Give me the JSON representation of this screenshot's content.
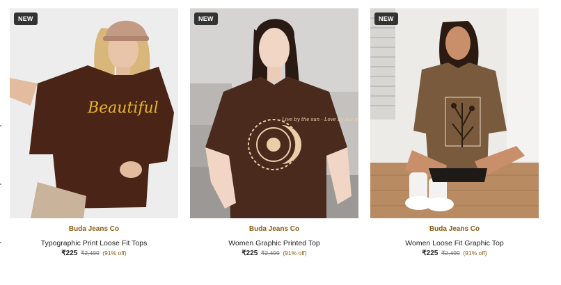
{
  "products": [
    {
      "badge": "NEW",
      "brand": "Buda Jeans Co",
      "name": "Typographic Print Loose Fit Tops",
      "price": "₹225",
      "mrp": "₹2,499",
      "discount": "(91% off)",
      "print_text": "Beautiful"
    },
    {
      "badge": "NEW",
      "brand": "Buda Jeans Co",
      "name": "Women Graphic Printed Top",
      "price": "₹225",
      "mrp": "₹2,499",
      "discount": "(91% off)",
      "print_text": "Live by the sun · Love by the moon"
    },
    {
      "badge": "NEW",
      "brand": "Buda Jeans Co",
      "name": "Women Loose Fit Graphic Top",
      "price": "₹225",
      "mrp": "₹2,499",
      "discount": "(91% off)",
      "print_text": ""
    }
  ],
  "colors": {
    "brand": "#8a5a12",
    "badge_bg": "#333333",
    "shirt_dark": "#4a2416",
    "shirt_mid": "#4b2a1e",
    "shirt_olive": "#7a5a3c"
  }
}
